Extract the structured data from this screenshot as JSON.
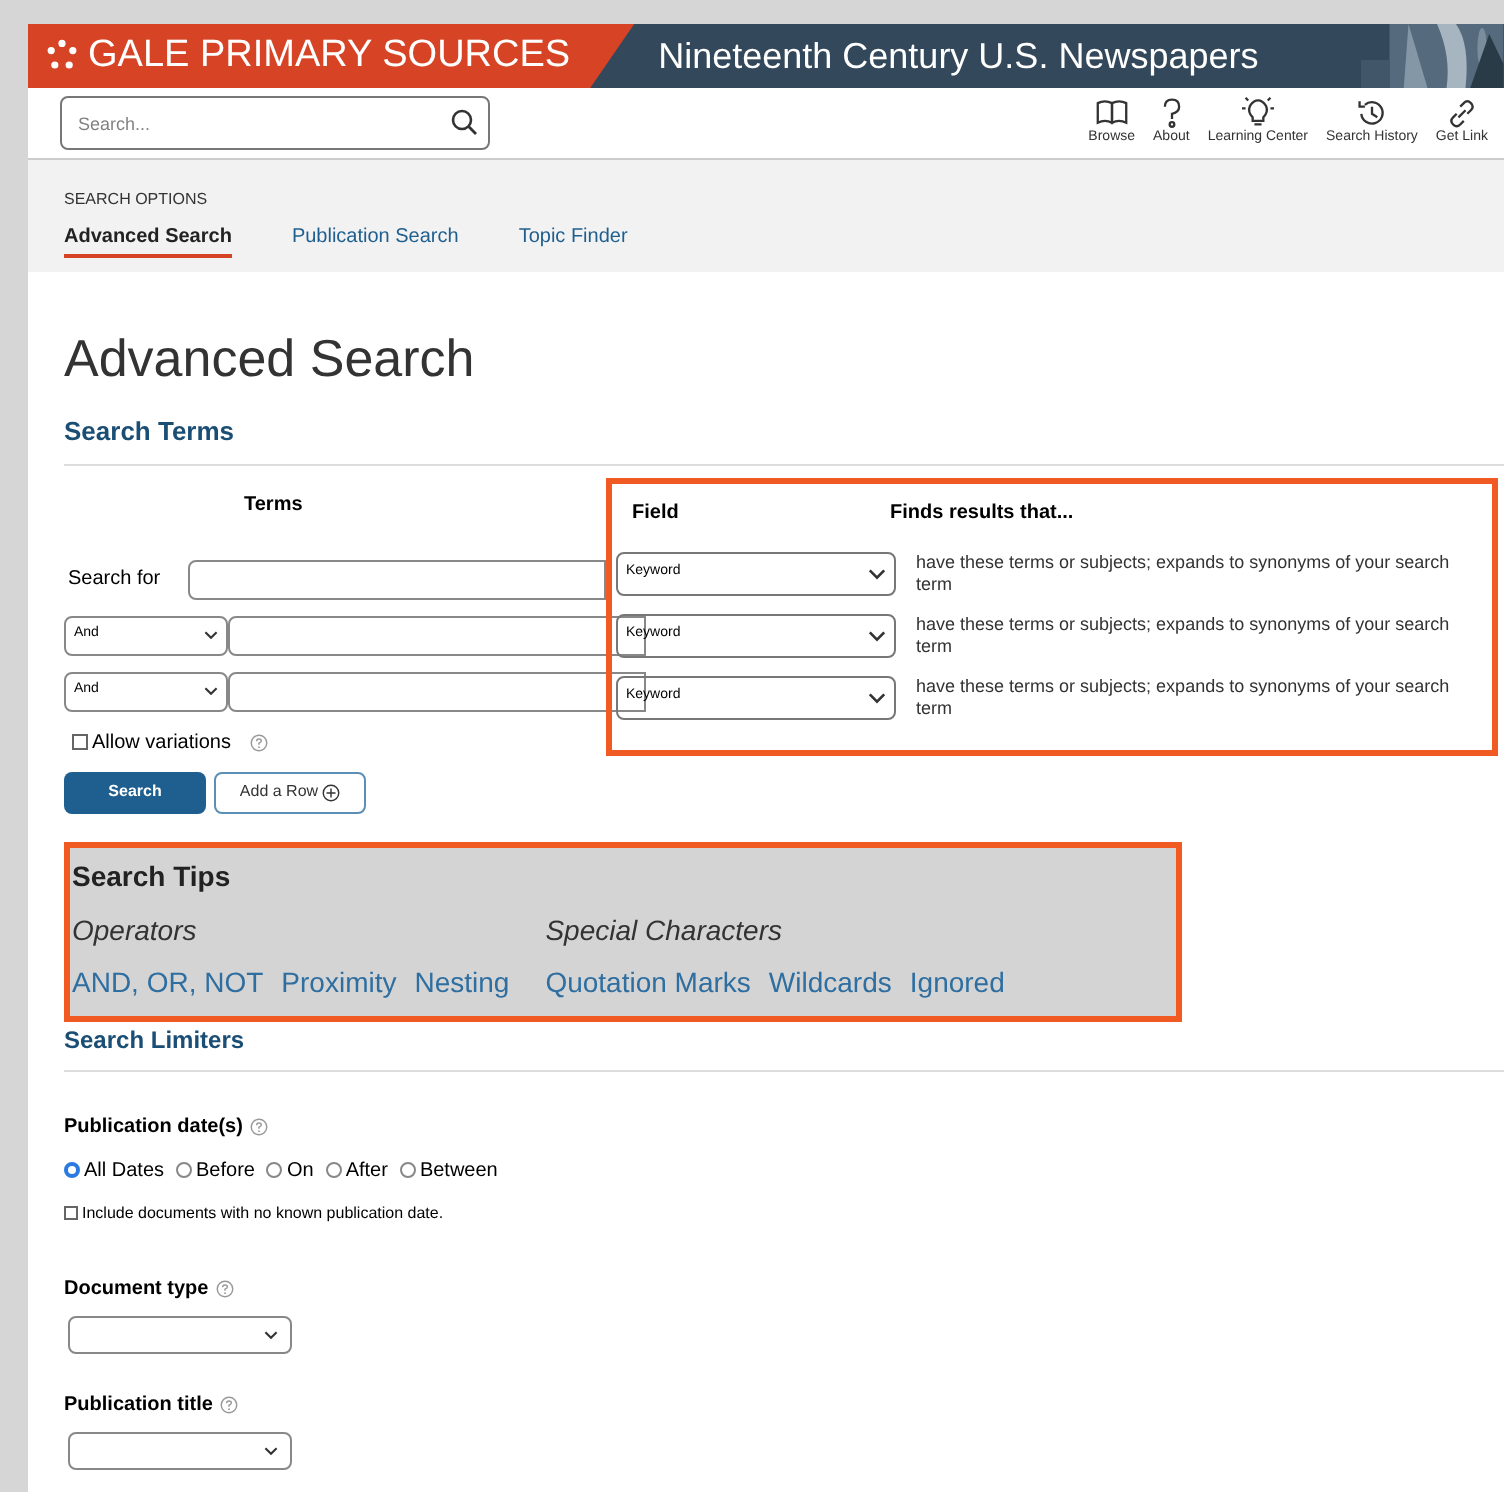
{
  "header": {
    "brand": "GALE PRIMARY SOURCES",
    "collection": "Nineteenth Century U.S. Newspapers"
  },
  "search": {
    "placeholder": "Search..."
  },
  "toolbar": [
    {
      "kind": "book",
      "label": "Browse"
    },
    {
      "kind": "question",
      "label": "About"
    },
    {
      "kind": "bulb",
      "label": "Learning Center"
    },
    {
      "kind": "history",
      "label": "Search History"
    },
    {
      "kind": "link",
      "label": "Get Link"
    }
  ],
  "search_options": {
    "heading": "SEARCH OPTIONS",
    "tabs": [
      {
        "label": "Advanced Search",
        "selected": true
      },
      {
        "label": "Publication Search",
        "selected": false
      },
      {
        "label": "Topic Finder",
        "selected": false
      }
    ]
  },
  "page_title": "Advanced Search",
  "search_terms": {
    "heading": "Search Terms",
    "terms_header": "Terms",
    "field_header": "Field",
    "finds_header": "Finds results that...",
    "rows": [
      {
        "label": "Search for",
        "field": "Keyword",
        "finds": "have these terms or subjects; expands to synonyms of your search term"
      },
      {
        "operator": "And",
        "field": "Keyword",
        "finds": "have these terms or subjects; expands to synonyms of your search term"
      },
      {
        "operator": "And",
        "field": "Keyword",
        "finds": "have these terms or subjects; expands to synonyms of your search term"
      }
    ],
    "allow_variations": {
      "label": "Allow variations",
      "checked": false
    },
    "buttons": {
      "search": "Search",
      "add_row": "Add a Row"
    }
  },
  "search_tips": {
    "heading": "Search Tips",
    "groups": [
      {
        "title": "Operators",
        "links": [
          "AND, OR, NOT",
          "Proximity",
          "Nesting"
        ]
      },
      {
        "title": "Special Characters",
        "links": [
          "Quotation Marks",
          "Wildcards",
          "Ignored"
        ]
      }
    ]
  },
  "search_limiters": {
    "heading": "Search Limiters",
    "publication_dates": {
      "label": "Publication date(s)",
      "options": [
        {
          "label": "All Dates",
          "selected": true
        },
        {
          "label": "Before",
          "selected": false
        },
        {
          "label": "On",
          "selected": false
        },
        {
          "label": "After",
          "selected": false
        },
        {
          "label": "Between",
          "selected": false
        }
      ]
    },
    "include_undated": {
      "label": "Include documents with no known publication date.",
      "checked": false
    },
    "document_type": {
      "label": "Document type"
    },
    "publication_title": {
      "label": "Publication title"
    }
  }
}
